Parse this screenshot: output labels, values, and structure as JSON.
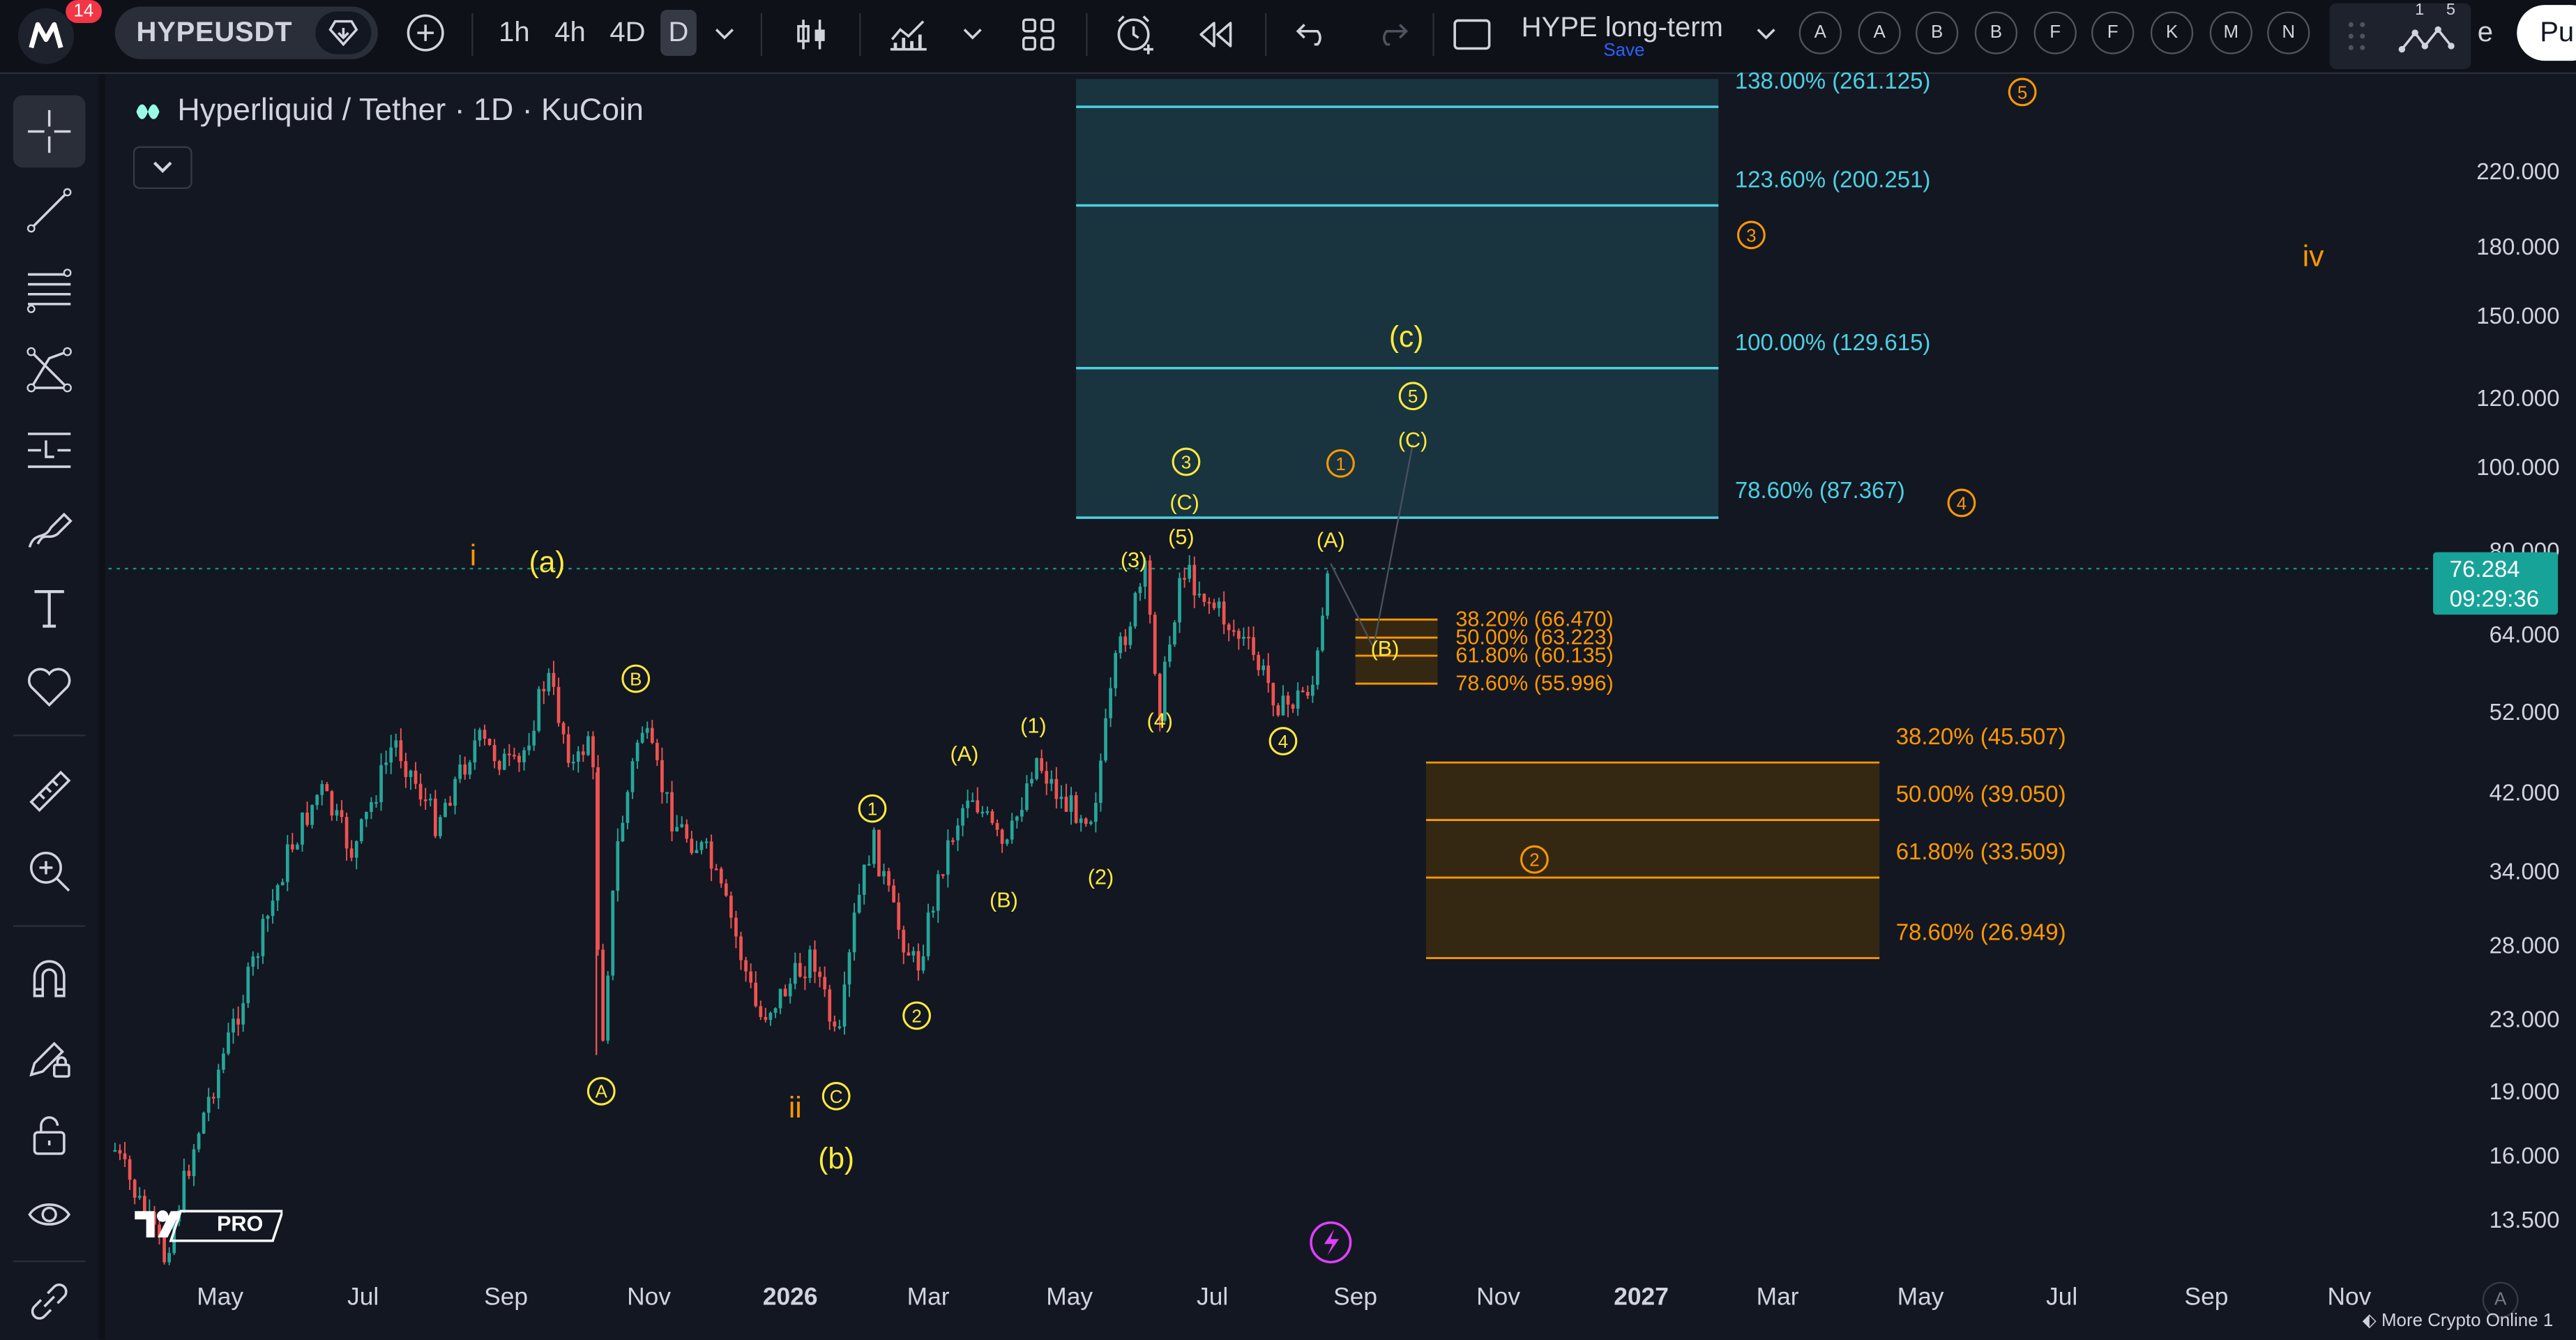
{
  "topbar": {
    "notifications": "14",
    "symbol": "HYPEUSDT",
    "intervals": [
      "1h",
      "4h",
      "4D",
      "D"
    ],
    "active_interval": "D",
    "layout_name": "HYPE long-term",
    "save_label": "Save",
    "alert_letters": [
      "A",
      "A",
      "B",
      "B",
      "F",
      "F",
      "K",
      "M",
      "N"
    ],
    "multi_chart_counts": [
      "1",
      "5"
    ],
    "publish_label": "Pu",
    "cut_letter": "e"
  },
  "legend": {
    "title": "Hyperliquid / Tether · 1D · KuCoin"
  },
  "price_axis": {
    "ticks": [
      "220.000",
      "180.000",
      "150.000",
      "120.000",
      "100.000",
      "80.000",
      "64.000",
      "52.000",
      "42.000",
      "34.000",
      "28.000",
      "23.000",
      "19.000",
      "16.000",
      "13.500"
    ]
  },
  "time_axis": {
    "ticks": [
      "May",
      "Jul",
      "Sep",
      "Nov",
      "2026",
      "Mar",
      "May",
      "Jul",
      "Sep",
      "Nov",
      "2027",
      "Mar",
      "May",
      "Jul",
      "Sep",
      "Nov"
    ],
    "bold": [
      "2026",
      "2027"
    ]
  },
  "last_price": {
    "value": "76.284",
    "countdown": "09:29:36"
  },
  "fib_extension": {
    "levels": [
      "138.00% (261.125)",
      "123.60% (200.251)",
      "100.00% (129.615)",
      "78.60% (87.367)"
    ],
    "color": "#4dd0e1"
  },
  "fib_retrace_small": {
    "levels": [
      "38.20% (66.470)",
      "50.00% (63.223)",
      "61.80% (60.135)",
      "78.60% (55.996)"
    ],
    "color": "#ff9800"
  },
  "fib_retrace_large": {
    "levels": [
      "38.20% (45.507)",
      "50.00% (39.050)",
      "61.80% (33.509)",
      "78.60% (26.949)"
    ],
    "color": "#ff9800"
  },
  "wave_labels": {
    "yellow_circled": [
      "A",
      "B",
      "C",
      "1",
      "2",
      "3",
      "4",
      "5",
      "1"
    ],
    "yellow_paren": [
      "(a)",
      "(b)",
      "(c)",
      "(1)",
      "(2)",
      "(3)",
      "(4)",
      "(5)",
      "(A)",
      "(B)",
      "(C)",
      "(A)",
      "(B)",
      "(C)"
    ],
    "orange": [
      "i",
      "ii",
      "iv",
      "1",
      "2",
      "3",
      "4",
      "5"
    ]
  },
  "branding": {
    "logo_text": "PRO"
  },
  "footer": {
    "watermark": "More Crypto Online 1",
    "axis_button": "A"
  },
  "colors": {
    "background": "#131722",
    "up_candle": "#26a69a",
    "down_candle": "#ef5350",
    "wave_yellow": "#ffeb3b",
    "wave_orange": "#ff9800",
    "price_tag": "#17a398"
  }
}
